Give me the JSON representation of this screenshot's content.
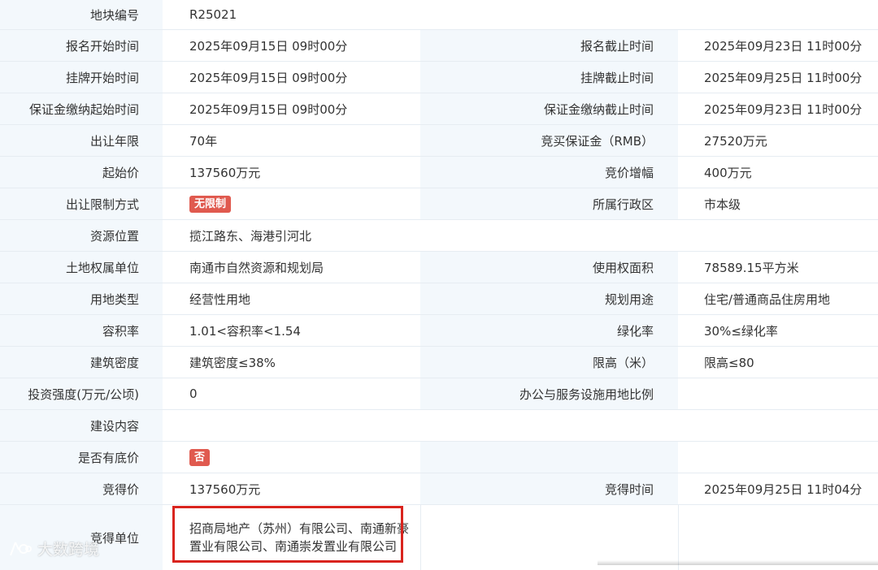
{
  "rows": [
    {
      "l1": "地块编号",
      "v1": "R25021"
    },
    {
      "l1": "报名开始时间",
      "v1": "2025年09月15日 09时00分",
      "l2": "报名截止时间",
      "v2": "2025年09月23日 11时00分"
    },
    {
      "l1": "挂牌开始时间",
      "v1": "2025年09月15日 09时00分",
      "l2": "挂牌截止时间",
      "v2": "2025年09月25日 11时00分"
    },
    {
      "l1": "保证金缴纳起始时间",
      "v1": "2025年09月15日 09时00分",
      "l2": "保证金缴纳截止时间",
      "v2": "2025年09月23日 11时00分"
    },
    {
      "l1": "出让年限",
      "v1": "70年",
      "l2": "竞买保证金（RMB）",
      "v2": "27520万元"
    },
    {
      "l1": "起始价",
      "v1": "137560万元",
      "l2": "竞价增幅",
      "v2": "400万元"
    },
    {
      "l1": "出让限制方式",
      "v1": "无限制",
      "l2": "所属行政区",
      "v2": "市本级"
    },
    {
      "l1": "资源位置",
      "v1": "揽江路东、海港引河北"
    },
    {
      "l1": "土地权属单位",
      "v1": "南通市自然资源和规划局",
      "l2": "使用权面积",
      "v2": "78589.15平方米"
    },
    {
      "l1": "用地类型",
      "v1": "经营性用地",
      "l2": "规划用途",
      "v2": "住宅/普通商品住房用地"
    },
    {
      "l1": "容积率",
      "v1": "1.01<容积率<1.54",
      "l2": "绿化率",
      "v2": "30%≤绿化率"
    },
    {
      "l1": "建筑密度",
      "v1": "建筑密度≤38%",
      "l2": "限高（米）",
      "v2": "限高≤80"
    },
    {
      "l1": "投资强度(万元/公顷)",
      "v1": "0",
      "l2": "办公与服务设施用地比例",
      "v2": ""
    },
    {
      "l1": "建设内容",
      "v1": ""
    },
    {
      "l1": "是否有底价",
      "v1": "否",
      "l2": "",
      "v2": ""
    },
    {
      "l1": "竞得价",
      "v1": "137560万元",
      "l2": "竞得时间",
      "v2": "2025年09月25日 11时04分"
    },
    {
      "l1": "竞得单位",
      "v1": "招商局地产（苏州）有限公司、南通新豪置业有限公司、南通崇发置业有限公司",
      "l2": "",
      "v2": ""
    }
  ],
  "watermark": "大数跨境",
  "colors": {
    "label_bg": "#f3f8fc",
    "badge": "#e05a4f",
    "highlight": "#d9241e"
  }
}
